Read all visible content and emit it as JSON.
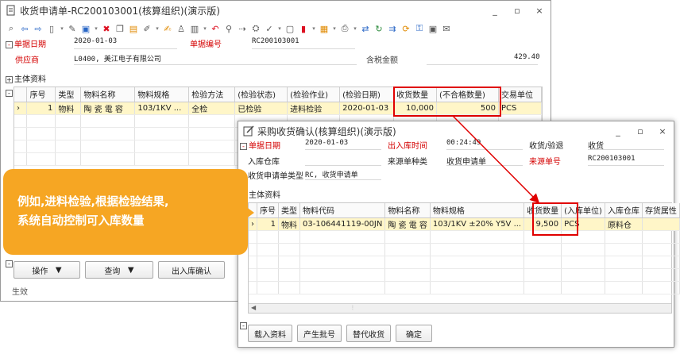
{
  "w1": {
    "title": "收货申请单-RC200103001(核算组织)(演示版)",
    "controls": {
      "min": "_",
      "max": "▫",
      "close": "×"
    },
    "header": {
      "date_label": "单据日期",
      "date_value": "2020-01-03",
      "billno_label": "单据编号",
      "billno_value": "RC200103001",
      "supplier_label": "供应商",
      "supplier_value": "L0400, 美江电子有限公司",
      "total_label": "含税金额",
      "total_value": "429.40"
    },
    "section": "主体资料",
    "columns": [
      "序号",
      "类型",
      "物料名称",
      "物料规格",
      "检验方法",
      "(检验状态)",
      "(检验作业)",
      "(检验日期)",
      "收货数量",
      "(不合格数量)",
      "交易单位"
    ],
    "row": [
      "1",
      "物料",
      "陶 瓷 電 容",
      "103/1KV ...",
      "全检",
      "已检验",
      "进料检验",
      "2020-01-03",
      "10,000",
      "500",
      "PCS"
    ],
    "buttons": {
      "op": "操作",
      "query": "查询",
      "confirm": "出入库确认"
    },
    "status": "生效"
  },
  "w2": {
    "title": "采购收货确认(核算组织)(演示版)",
    "controls": {
      "min": "_",
      "max": "▫",
      "close": "×"
    },
    "header": {
      "date_label": "单据日期",
      "date_value": "2020-01-03",
      "iotime_label": "出入库时间",
      "iotime_value": "00:24:49",
      "rtype_label": "收货/验退",
      "rtype_value": "收货",
      "wh_label": "入库仓库",
      "srctype_label": "来源单种类",
      "srctype_value": "收货申请单",
      "srcno_label": "来源单号",
      "srcno_value": "RC200103001",
      "reqtype_label": "收货申请单类型",
      "reqtype_value": "RC, 收货申请单"
    },
    "section": "主体资料",
    "columns": [
      "序号",
      "类型",
      "物料代码",
      "物料名称",
      "物料规格",
      "收货数量",
      "(入库单位)",
      "入库仓库",
      "存货属性"
    ],
    "row": [
      "1",
      "物料",
      "03-106441119-00JN",
      "陶 瓷 電 容",
      "103/1KV ±20% Y5V ...",
      "9,500",
      "PCS",
      "原料仓",
      ""
    ],
    "buttons": {
      "load": "载入资料",
      "batch": "产生批号",
      "substitute": "替代收货",
      "ok": "确定"
    }
  },
  "callout": {
    "line1": "例如,进料检验,根据检验结果,",
    "line2": "系统自动控制可入库数量"
  },
  "colors": {
    "accent": "#f6a623",
    "highlight": "#e00000",
    "selected_row": "#fff6c8"
  }
}
